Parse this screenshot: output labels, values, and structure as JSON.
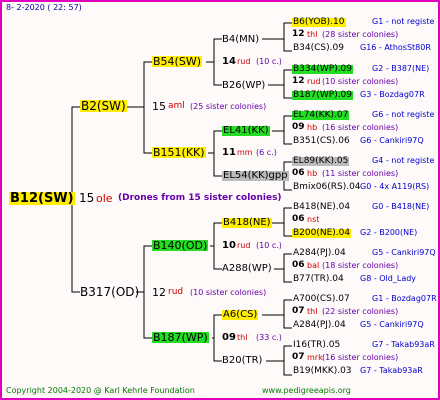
{
  "header_date": "8-  2-2020 ( 22: 57)",
  "root": {
    "id": "B12(SW)",
    "count": "15",
    "breeder": "ole",
    "note": "(Drones from 15 sister colonies)"
  },
  "gen1": [
    {
      "id": "B2(SW)",
      "count": "15",
      "breeder": "aml",
      "note": "(25 sister colonies)"
    },
    {
      "id": "B317(OD)",
      "count": "12",
      "breeder": "rud",
      "note": "(10 sister colonies)"
    }
  ],
  "gen2": [
    {
      "id": "B54(SW)",
      "count": "14",
      "breeder": "rud",
      "note": "(10 c.)",
      "mother": "B4(MN)",
      "father": "B26(WP)"
    },
    {
      "id": "B151(KK)",
      "count": "11",
      "breeder": "mm",
      "note": "(6 c.)",
      "mother": "EL41(KK)",
      "father": "EL54(KK)gpp"
    },
    {
      "id": "B140(OD)",
      "count": "10",
      "breeder": "rud",
      "note": "(10 c.)",
      "mother": "B418(NE)",
      "father": "A288(WP)"
    },
    {
      "id": "B187(WP)",
      "count": "09",
      "breeder": "thl",
      "note": "(33 c.)",
      "mother": "A6(CS)",
      "father": "B20(TR)"
    }
  ],
  "gen3": [
    {
      "a": "B6(YOB).10",
      "a_ref": "G1 - not registe",
      "c": "12",
      "br": "thl",
      "note": "(28 sister colonies)",
      "b": "B34(CS).09",
      "b_ref": "G16 - AthosSt80R"
    },
    {
      "a": "B334(WP).09",
      "a_ref": "G2 - B387(NE)",
      "c": "12",
      "br": "rud",
      "note": "(10 sister colonies)",
      "b": "B187(WP).09",
      "b_ref": "G3 - Bozdag07R"
    },
    {
      "a": "EL74(KK).07",
      "a_ref": "G6 - not registe",
      "c": "09",
      "br": "hb",
      "note": "(16 sister colonies)",
      "b": "B351(CS).06",
      "b_ref": "G6 - Cankiri97Q"
    },
    {
      "a": "EL89(KK).05",
      "a_ref": "G4 - not registe",
      "c": "06",
      "br": "hb",
      "note": "(11 sister colonies)",
      "b": "Bmix06(RS).04",
      "b_ref": "G0 - 4x A119(RS)"
    },
    {
      "a": "B418(NE).04",
      "a_ref": "G0 - B418(NE)",
      "c": "06",
      "br": "nst",
      "note": "",
      "b": "B200(NE).04",
      "b_ref": "G2 - B200(NE)"
    },
    {
      "a": "A284(PJ).04",
      "a_ref": "G5 - Cankiri97Q",
      "c": "06",
      "br": "bal",
      "note": "(18 sister colonies)",
      "b": "B77(TR).04",
      "b_ref": "G8 - Old_Lady"
    },
    {
      "a": "A700(CS).07",
      "a_ref": "G1 - Bozdag07R",
      "c": "07",
      "br": "thl",
      "note": "(22 sister colonies)",
      "b": "A284(PJ).04",
      "b_ref": "G5 - Cankiri97Q"
    },
    {
      "a": "I16(TR).05",
      "a_ref": "G7 - Takab93aR",
      "c": "07",
      "br": "mrk",
      "note": "(16 sister colonies)",
      "b": "B19(MKK).03",
      "b_ref": "G7 - Takab93aR"
    }
  ],
  "footer": {
    "copyright": "Copyright 2004-2020 @ Karl Kehrle Foundation",
    "url": "www.pedigreeapis.org"
  },
  "colors": {
    "frame": "#e000c0",
    "yellow": "#ffee00",
    "green": "#22dd22",
    "gray": "#bbbbbb",
    "ref_blue": "#0000cc",
    "breeder_red": "#cc0000",
    "note_purple": "#6600aa"
  }
}
